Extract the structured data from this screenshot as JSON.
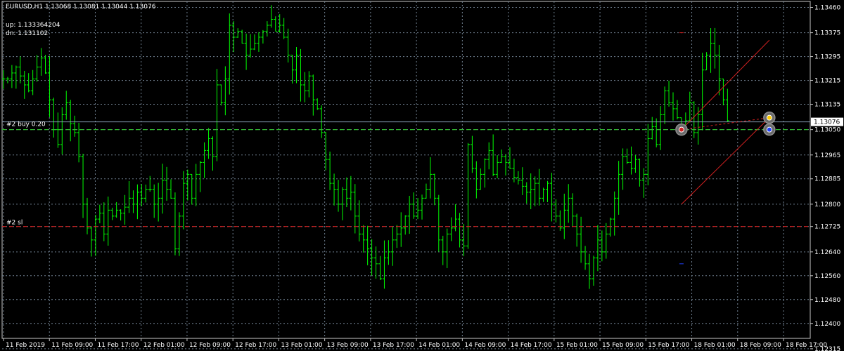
{
  "header": {
    "symbol_ohlc": "EURUSD,H1  1.13068 1.13081 1.13044 1.13076",
    "up_label": "up: 1.133364204",
    "dn_label": "dn: 1.131102"
  },
  "colors": {
    "background": "#000000",
    "candle": "#00ff00",
    "grid": "#708090",
    "bid_line": "#8aa0b8",
    "entry_line": "#2eb82e",
    "sl_line": "#d02020",
    "channel": "#d02020",
    "current_price_bg": "#ffffff",
    "text": "#ffffff"
  },
  "chart_data": {
    "type": "candlestick",
    "symbol": "EURUSD",
    "timeframe": "H1",
    "ylim": [
      1.1235,
      1.1348
    ],
    "current_price": "1.13076",
    "y_ticks": [
      "1.13460",
      "1.13375",
      "1.13295",
      "1.13215",
      "1.13135",
      "1.13050",
      "1.12965",
      "1.12885",
      "1.12800",
      "1.12725",
      "1.12640",
      "1.12560",
      "1.12480",
      "1.12400",
      "1.12315"
    ],
    "x_ticks": [
      "11 Feb 2019",
      "11 Feb 09:00",
      "11 Feb 17:00",
      "12 Feb 01:00",
      "12 Feb 09:00",
      "12 Feb 17:00",
      "13 Feb 01:00",
      "13 Feb 09:00",
      "13 Feb 17:00",
      "14 Feb 01:00",
      "14 Feb 09:00",
      "14 Feb 17:00",
      "15 Feb 01:00",
      "15 Feb 09:00",
      "15 Feb 17:00",
      "18 Feb 01:00",
      "18 Feb 09:00",
      "18 Feb 17:00"
    ],
    "close_path": [
      1.1322,
      1.1322,
      1.1324,
      1.1326,
      1.1323,
      1.132,
      1.1318,
      1.1322,
      1.1326,
      1.1329,
      1.1324,
      1.1315,
      1.1305,
      1.13,
      1.131,
      1.1314,
      1.1307,
      1.1304,
      1.1296,
      1.128,
      1.1272,
      1.1268,
      1.1275,
      1.1277,
      1.127,
      1.1278,
      1.1276,
      1.1278,
      1.1277,
      1.1279,
      1.1282,
      1.128,
      1.1284,
      1.1282,
      1.1285,
      1.1285,
      1.128,
      1.1282,
      1.1288,
      1.1285,
      1.1282,
      1.1265,
      1.1276,
      1.1287,
      1.129,
      1.1282,
      1.129,
      1.1294,
      1.1298,
      1.1302,
      1.1296,
      1.132,
      1.1314,
      1.1322,
      1.134,
      1.1336,
      1.1338,
      1.1334,
      1.133,
      1.1332,
      1.1334,
      1.1336,
      1.1338,
      1.134,
      1.1342,
      1.1338,
      1.134,
      1.1336,
      1.133,
      1.1325,
      1.133,
      1.132,
      1.1318,
      1.1323,
      1.1315,
      1.1312,
      1.1304,
      1.1295,
      1.1287,
      1.1285,
      1.128,
      1.1285,
      1.1282,
      1.1284,
      1.1276,
      1.127,
      1.1268,
      1.1265,
      1.1262,
      1.126,
      1.1255,
      1.1262,
      1.1264,
      1.1268,
      1.127,
      1.1272,
      1.1276,
      1.128,
      1.1276,
      1.1278,
      1.1282,
      1.1285,
      1.129,
      1.1282,
      1.1268,
      1.1264,
      1.127,
      1.1272,
      1.1275,
      1.1268,
      1.1266,
      1.13,
      1.1292,
      1.1285,
      1.129,
      1.1295,
      1.1298,
      1.129,
      1.1294,
      1.1296,
      1.1294,
      1.1292,
      1.1289,
      1.1288,
      1.1286,
      1.1284,
      1.1285,
      1.1287,
      1.1282,
      1.1285,
      1.1287,
      1.128,
      1.1276,
      1.1272,
      1.1278,
      1.1282,
      1.1276,
      1.127,
      1.1264,
      1.126,
      1.1255,
      1.1262,
      1.1268,
      1.1264,
      1.127,
      1.1275,
      1.1282,
      1.129,
      1.1296,
      1.1294,
      1.1292,
      1.1295,
      1.1288,
      1.129,
      1.1302,
      1.1306,
      1.13,
      1.131,
      1.1318,
      1.1314,
      1.1312,
      1.1309,
      1.1306,
      1.1308,
      1.1314,
      1.1304,
      1.131,
      1.1325,
      1.133,
      1.1334,
      1.133,
      1.1322,
      1.1315,
      1.1308
    ]
  },
  "levels": {
    "buy_label": "#2 buy 0.20",
    "buy_price": 1.1305,
    "sl_label": "#2 sl",
    "sl_price": 1.12725,
    "bid_price": 1.13076
  },
  "channel": {
    "upper": [
      [
        1.1305,
        1.1347
      ],
      [
        1.1308,
        1.1335
      ]
    ],
    "lower": [
      [
        1.128,
        1.13065
      ],
      [
        1.1287,
        1.1309
      ]
    ]
  },
  "markers": [
    {
      "name": "trade-open-marker",
      "price": 1.1305,
      "color": "#d02020"
    },
    {
      "name": "trade-target-marker",
      "price": 1.1309,
      "color": "#ffcc00"
    },
    {
      "name": "trade-close-marker",
      "price": 1.1305,
      "color": "#2040ff"
    }
  ]
}
